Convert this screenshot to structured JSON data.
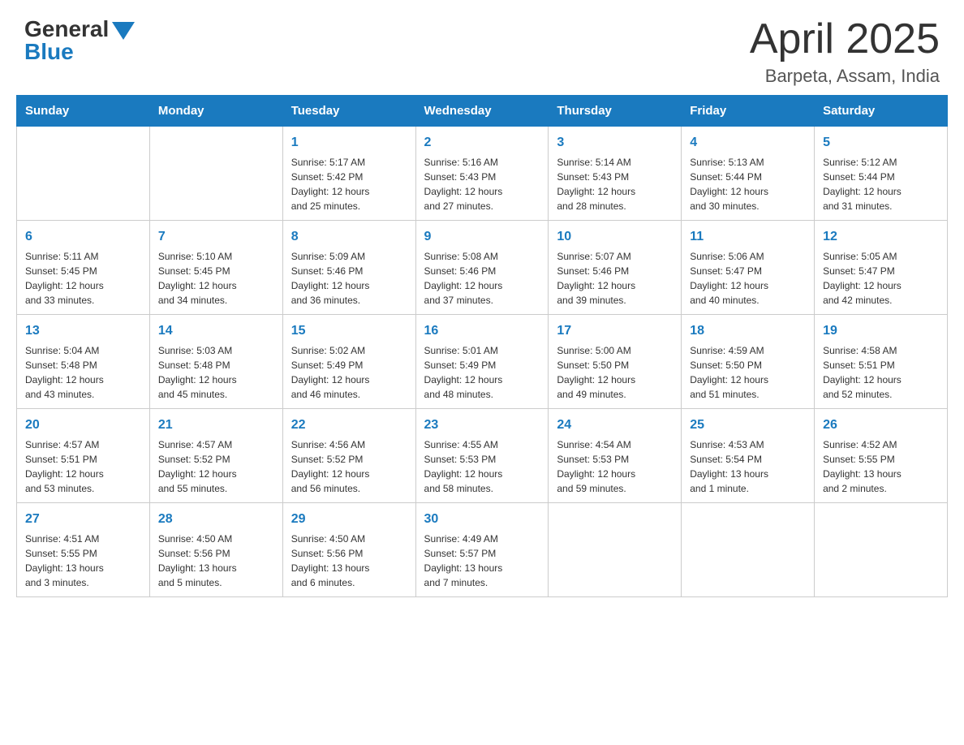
{
  "header": {
    "logo_general": "General",
    "logo_blue": "Blue",
    "title": "April 2025",
    "subtitle": "Barpeta, Assam, India"
  },
  "days_of_week": [
    "Sunday",
    "Monday",
    "Tuesday",
    "Wednesday",
    "Thursday",
    "Friday",
    "Saturday"
  ],
  "weeks": [
    [
      {
        "day": "",
        "info": ""
      },
      {
        "day": "",
        "info": ""
      },
      {
        "day": "1",
        "info": "Sunrise: 5:17 AM\nSunset: 5:42 PM\nDaylight: 12 hours\nand 25 minutes."
      },
      {
        "day": "2",
        "info": "Sunrise: 5:16 AM\nSunset: 5:43 PM\nDaylight: 12 hours\nand 27 minutes."
      },
      {
        "day": "3",
        "info": "Sunrise: 5:14 AM\nSunset: 5:43 PM\nDaylight: 12 hours\nand 28 minutes."
      },
      {
        "day": "4",
        "info": "Sunrise: 5:13 AM\nSunset: 5:44 PM\nDaylight: 12 hours\nand 30 minutes."
      },
      {
        "day": "5",
        "info": "Sunrise: 5:12 AM\nSunset: 5:44 PM\nDaylight: 12 hours\nand 31 minutes."
      }
    ],
    [
      {
        "day": "6",
        "info": "Sunrise: 5:11 AM\nSunset: 5:45 PM\nDaylight: 12 hours\nand 33 minutes."
      },
      {
        "day": "7",
        "info": "Sunrise: 5:10 AM\nSunset: 5:45 PM\nDaylight: 12 hours\nand 34 minutes."
      },
      {
        "day": "8",
        "info": "Sunrise: 5:09 AM\nSunset: 5:46 PM\nDaylight: 12 hours\nand 36 minutes."
      },
      {
        "day": "9",
        "info": "Sunrise: 5:08 AM\nSunset: 5:46 PM\nDaylight: 12 hours\nand 37 minutes."
      },
      {
        "day": "10",
        "info": "Sunrise: 5:07 AM\nSunset: 5:46 PM\nDaylight: 12 hours\nand 39 minutes."
      },
      {
        "day": "11",
        "info": "Sunrise: 5:06 AM\nSunset: 5:47 PM\nDaylight: 12 hours\nand 40 minutes."
      },
      {
        "day": "12",
        "info": "Sunrise: 5:05 AM\nSunset: 5:47 PM\nDaylight: 12 hours\nand 42 minutes."
      }
    ],
    [
      {
        "day": "13",
        "info": "Sunrise: 5:04 AM\nSunset: 5:48 PM\nDaylight: 12 hours\nand 43 minutes."
      },
      {
        "day": "14",
        "info": "Sunrise: 5:03 AM\nSunset: 5:48 PM\nDaylight: 12 hours\nand 45 minutes."
      },
      {
        "day": "15",
        "info": "Sunrise: 5:02 AM\nSunset: 5:49 PM\nDaylight: 12 hours\nand 46 minutes."
      },
      {
        "day": "16",
        "info": "Sunrise: 5:01 AM\nSunset: 5:49 PM\nDaylight: 12 hours\nand 48 minutes."
      },
      {
        "day": "17",
        "info": "Sunrise: 5:00 AM\nSunset: 5:50 PM\nDaylight: 12 hours\nand 49 minutes."
      },
      {
        "day": "18",
        "info": "Sunrise: 4:59 AM\nSunset: 5:50 PM\nDaylight: 12 hours\nand 51 minutes."
      },
      {
        "day": "19",
        "info": "Sunrise: 4:58 AM\nSunset: 5:51 PM\nDaylight: 12 hours\nand 52 minutes."
      }
    ],
    [
      {
        "day": "20",
        "info": "Sunrise: 4:57 AM\nSunset: 5:51 PM\nDaylight: 12 hours\nand 53 minutes."
      },
      {
        "day": "21",
        "info": "Sunrise: 4:57 AM\nSunset: 5:52 PM\nDaylight: 12 hours\nand 55 minutes."
      },
      {
        "day": "22",
        "info": "Sunrise: 4:56 AM\nSunset: 5:52 PM\nDaylight: 12 hours\nand 56 minutes."
      },
      {
        "day": "23",
        "info": "Sunrise: 4:55 AM\nSunset: 5:53 PM\nDaylight: 12 hours\nand 58 minutes."
      },
      {
        "day": "24",
        "info": "Sunrise: 4:54 AM\nSunset: 5:53 PM\nDaylight: 12 hours\nand 59 minutes."
      },
      {
        "day": "25",
        "info": "Sunrise: 4:53 AM\nSunset: 5:54 PM\nDaylight: 13 hours\nand 1 minute."
      },
      {
        "day": "26",
        "info": "Sunrise: 4:52 AM\nSunset: 5:55 PM\nDaylight: 13 hours\nand 2 minutes."
      }
    ],
    [
      {
        "day": "27",
        "info": "Sunrise: 4:51 AM\nSunset: 5:55 PM\nDaylight: 13 hours\nand 3 minutes."
      },
      {
        "day": "28",
        "info": "Sunrise: 4:50 AM\nSunset: 5:56 PM\nDaylight: 13 hours\nand 5 minutes."
      },
      {
        "day": "29",
        "info": "Sunrise: 4:50 AM\nSunset: 5:56 PM\nDaylight: 13 hours\nand 6 minutes."
      },
      {
        "day": "30",
        "info": "Sunrise: 4:49 AM\nSunset: 5:57 PM\nDaylight: 13 hours\nand 7 minutes."
      },
      {
        "day": "",
        "info": ""
      },
      {
        "day": "",
        "info": ""
      },
      {
        "day": "",
        "info": ""
      }
    ]
  ]
}
